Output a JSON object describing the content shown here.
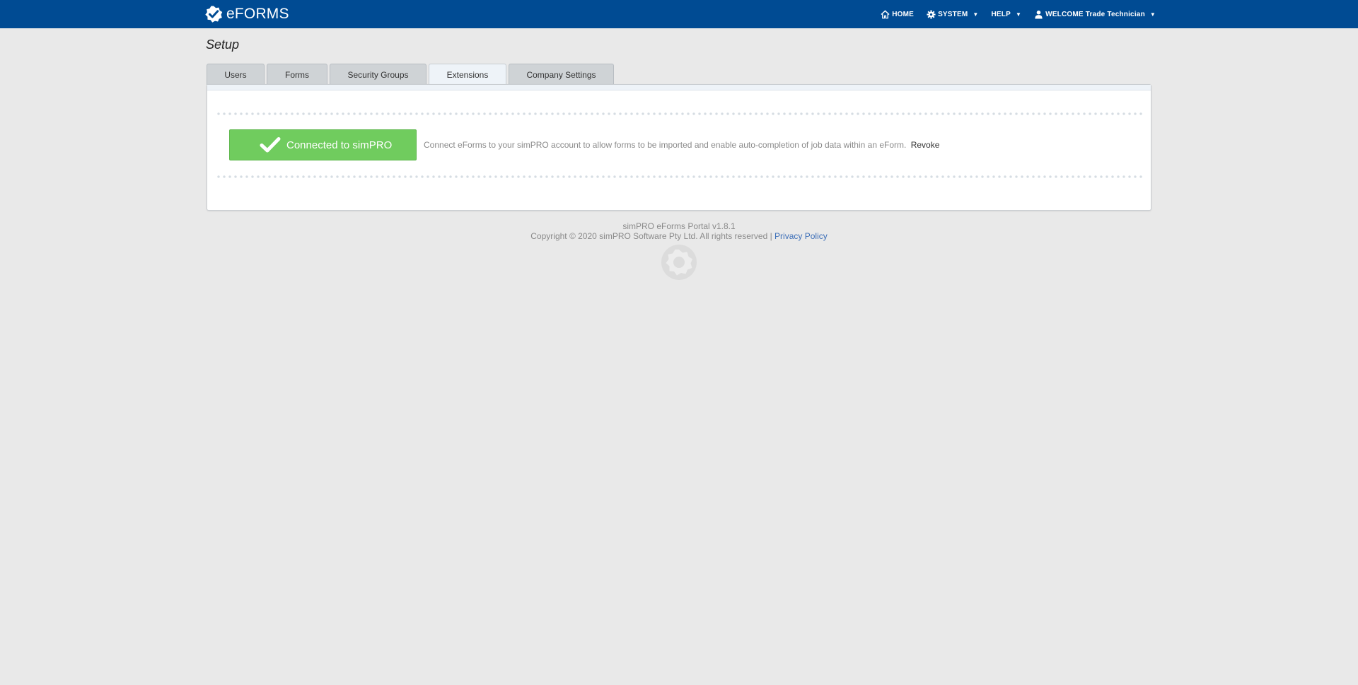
{
  "header": {
    "logo_text": "eFORMS",
    "nav": {
      "home": "HOME",
      "system": "SYSTEM",
      "help": "HELP",
      "welcome": "WELCOME Trade Technician"
    }
  },
  "page": {
    "title": "Setup"
  },
  "tabs": [
    {
      "label": "Users"
    },
    {
      "label": "Forms"
    },
    {
      "label": "Security Groups"
    },
    {
      "label": "Extensions"
    },
    {
      "label": "Company Settings"
    }
  ],
  "active_tab": "Extensions",
  "extension": {
    "button_label": "Connected to simPRO",
    "description": "Connect eForms to your simPRO account to allow forms to be imported and enable auto-completion of job data within an eForm.",
    "revoke_label": "Revoke"
  },
  "footer": {
    "version": "simPRO eForms Portal v1.8.1",
    "copyright": "Copyright © 2020 simPRO Software Pty Ltd. All rights reserved |",
    "privacy_label": "Privacy Policy"
  },
  "colors": {
    "header_bg": "#004b93",
    "page_bg": "#e9e9e9",
    "success_green": "#70cc5e",
    "link_blue": "#3d6fb8"
  }
}
